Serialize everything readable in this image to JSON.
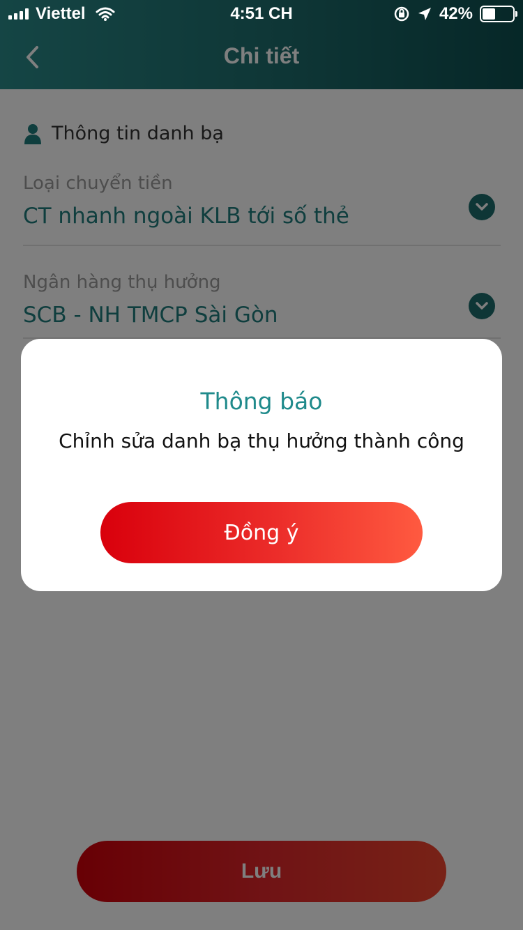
{
  "status_bar": {
    "carrier": "Viettel",
    "time": "4:51 CH",
    "battery_text": "42%",
    "battery_level": 0.42
  },
  "header": {
    "title": "Chi tiết"
  },
  "section": {
    "title": "Thông tin danh bạ"
  },
  "fields": {
    "transfer_type": {
      "label": "Loại chuyển tiền",
      "value": "CT nhanh ngoài KLB tới số thẻ"
    },
    "beneficiary_bank": {
      "label": "Ngân hàng thụ hưởng",
      "value": "SCB - NH TMCP Sài Gòn"
    }
  },
  "save_button": {
    "label": "Lưu"
  },
  "dialog": {
    "title": "Thông báo",
    "message": "Chỉnh sửa danh bạ thụ hưởng thành công",
    "ok_label": "Đồng ý"
  },
  "colors": {
    "header_start": "#2a8b8a",
    "header_end": "#0d4f50",
    "accent_teal": "#1f7c7d",
    "button_red": "#e0262a"
  }
}
